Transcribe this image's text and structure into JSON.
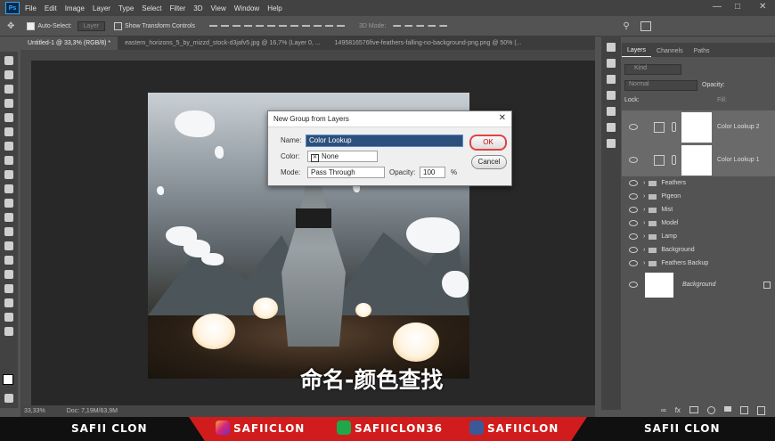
{
  "menubar": {
    "logo": "Ps",
    "items": [
      "File",
      "Edit",
      "Image",
      "Layer",
      "Type",
      "Select",
      "Filter",
      "3D",
      "View",
      "Window",
      "Help"
    ]
  },
  "options": {
    "auto_select": "Auto-Select:",
    "auto_select_value": "Layer",
    "show_transform": "Show Transform Controls",
    "mode_3d": "3D Mode:"
  },
  "tabs": [
    "Untitled-1 @ 33,3% (RGB/8) *",
    "eastern_horizons_5_by_mizzd_stock-d3jafv5.jpg @ 16,7% (Layer 0, ...",
    "1495816576five-feathers-falling-no-background-png.png @ 50% (..."
  ],
  "status": {
    "zoom": "33,33%",
    "doc": "Doc: 7,19M/63,9M"
  },
  "dialog": {
    "title": "New Group from Layers",
    "name_label": "Name:",
    "name_value": "Color Lookup",
    "color_label": "Color:",
    "color_value": "None",
    "mode_label": "Mode:",
    "mode_value": "Pass Through",
    "opacity_label": "Opacity:",
    "opacity_value": "100",
    "opacity_unit": "%",
    "ok_label": "OK",
    "cancel_label": "Cancel"
  },
  "layers_panel": {
    "tabs": [
      "Layers",
      "Channels",
      "Paths"
    ],
    "kind": "Kind",
    "blend": "Normal",
    "opacity_label": "Opacity:",
    "lock_label": "Lock:",
    "fill_label": "Fill:",
    "adjustments": [
      "Color Lookup 2",
      "Color Lookup 1"
    ],
    "groups": [
      "Feathers",
      "Pigeon",
      "Mist",
      "Model",
      "Lamp",
      "Background",
      "Feathers Backup"
    ],
    "background": "Background"
  },
  "subtitle": "命名-颜色查找",
  "banner": {
    "left": "SAFII CLON",
    "instagram": "SAFIICLON",
    "deviantart": "SAFIICLON36",
    "facebook": "SAFIICLON",
    "right": "SAFII CLON"
  }
}
